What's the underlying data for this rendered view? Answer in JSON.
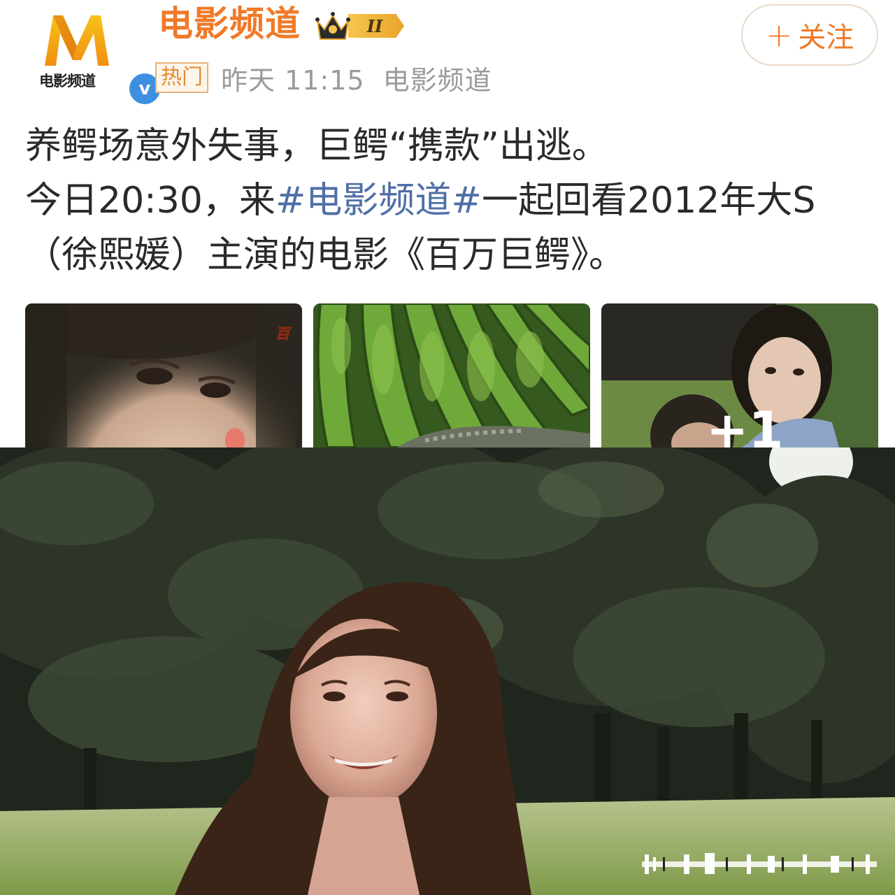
{
  "header": {
    "account_name": "电影频道",
    "avatar_text": "电影频道",
    "level_badge_label": "II",
    "hot_tag": "热门",
    "post_time": "昨天 11:15",
    "source": "电影频道",
    "follow_label": "关注",
    "follow_plus": "+",
    "verified_mark": "v"
  },
  "post": {
    "line1": "养鳄场意外失事，巨鳄“携款”出逃。",
    "line2_prefix": "今日20:30，来",
    "hashtag": "#电影频道#",
    "line2_suffix": "一起回看2012年大S",
    "line3": "（徐熙媛）主演的电影《百万巨鳄》。"
  },
  "thumbnails": {
    "thumb1_overlay_text": "百",
    "more_count": "+1"
  },
  "colors": {
    "brand_orange": "#f07a2a",
    "hashtag_blue": "#4f6fa6",
    "meta_gray": "#9a9a9a",
    "verified_blue": "#3d8fe0"
  },
  "icons": [
    "m-logo-icon",
    "verified-icon",
    "crown-icon",
    "plus-icon",
    "watermark-icon"
  ]
}
